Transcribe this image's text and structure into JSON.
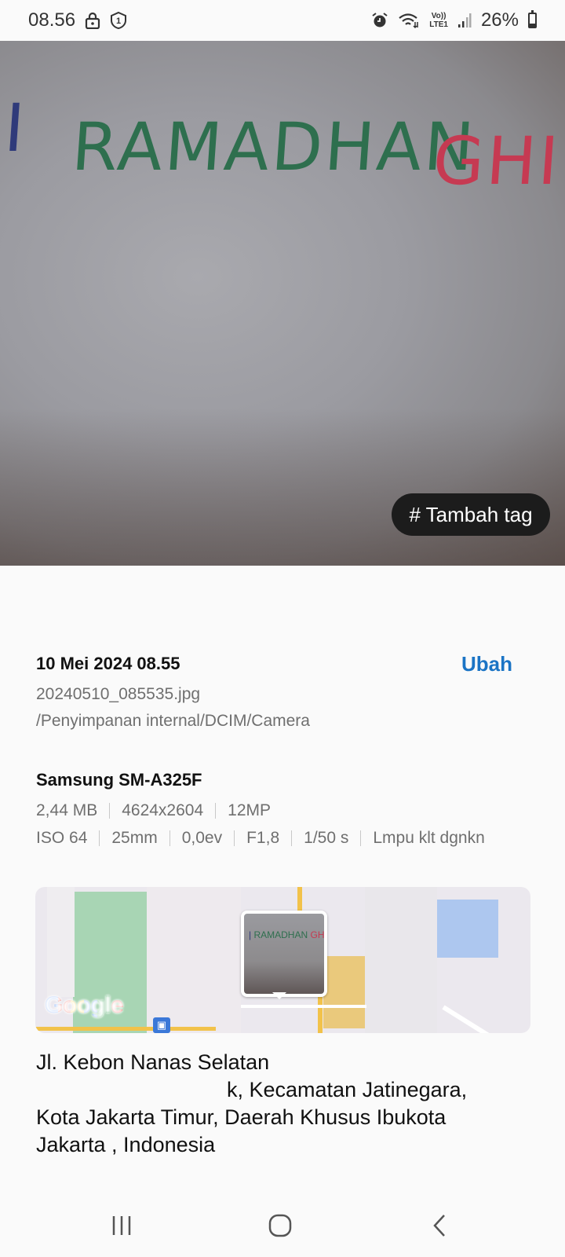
{
  "status_bar": {
    "time": "08.56",
    "signal_label_top": "Vo))",
    "signal_label_bottom": "LTE1",
    "battery": "26%",
    "battery_level": 0.26
  },
  "photo": {
    "handwriting_blue": "I",
    "handwriting_green": "RAMADHAN",
    "handwriting_red": "GHIF",
    "tag_button": "# Tambah tag"
  },
  "details": {
    "date": "10 Mei 2024 08.55",
    "edit_label": "Ubah",
    "filename": "20240510_085535.jpg",
    "path": "/Penyimpanan internal/DCIM/Camera",
    "device": "Samsung SM-A325F",
    "specs_row1": [
      "2,44 MB",
      "4624x2604",
      "12MP"
    ],
    "specs_row2": [
      "ISO 64",
      "25mm",
      "0,0ev",
      "F1,8",
      "1/50 s",
      "Lmpu klt dgnkn"
    ]
  },
  "map": {
    "logo": "Google",
    "thumb_text_green": "RAMADHAN",
    "thumb_text_red": "GHIF"
  },
  "address": {
    "line1": "Jl. Kebon Nanas Selatan",
    "line2": "k, Kecamatan Jatinegara,",
    "line3": "Kota Jakarta Timur, Daerah Khusus Ibukota",
    "line4": "Jakarta , Indonesia"
  },
  "nav": {
    "recent_icon": "recent-apps-icon",
    "home_icon": "home-icon",
    "back_icon": "back-icon"
  },
  "colors": {
    "accent": "#1b74c5",
    "tag_chip_bg": "#1c1c1c",
    "map_park": "#a8d5b4",
    "map_water": "#adc7ef",
    "map_road": "#f2c24a"
  }
}
